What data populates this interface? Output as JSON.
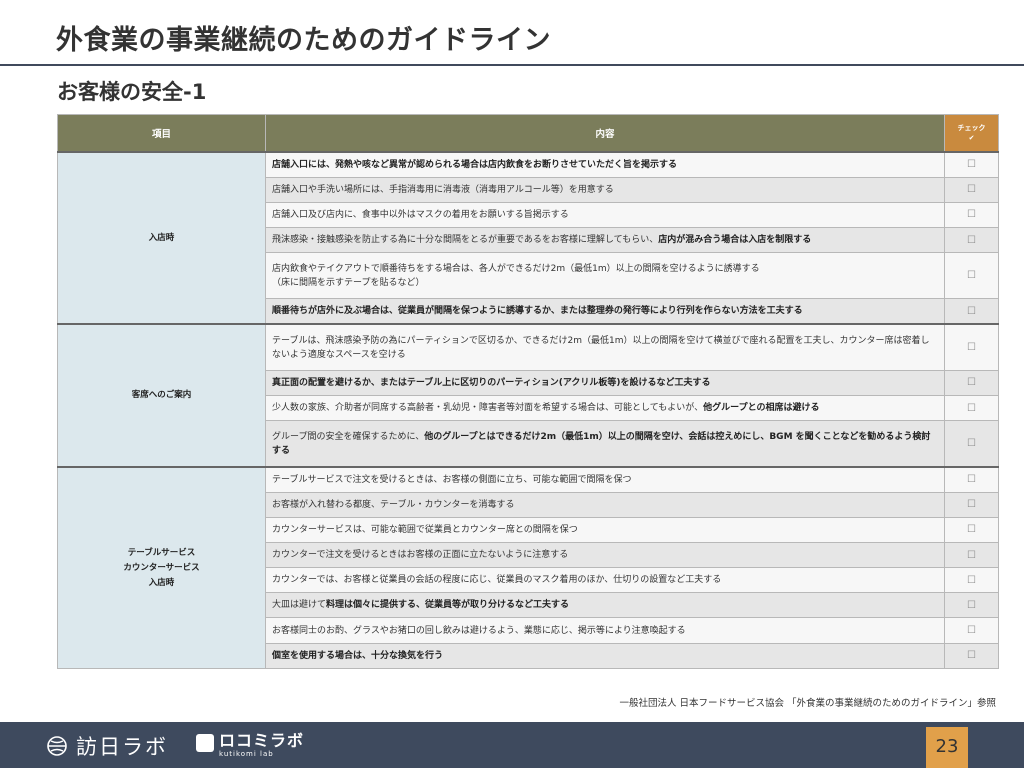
{
  "page": {
    "title": "外食業の事業継続のためのガイドライン",
    "subtitle": "お客様の安全-1"
  },
  "table": {
    "headers": {
      "category": "項目",
      "content": "内容",
      "check": "チェック",
      "check_mark": "✔"
    },
    "checkbox_glyph": "☐",
    "groups": [
      {
        "category_lines": [
          "入店時"
        ],
        "items": [
          {
            "segments": [
              {
                "text": "店舗入口には、発熱や咳など異常が認められる場合は店内飲食をお断りさせていただく旨を掲示する",
                "bold": true
              }
            ]
          },
          {
            "segments": [
              {
                "text": "店舗入口や手洗い場所には、手指消毒用に消毒液（消毒用アルコール等）を用意する",
                "bold": false
              }
            ]
          },
          {
            "segments": [
              {
                "text": "店舗入口及び店内に、食事中以外はマスクの着用をお願いする旨掲示する",
                "bold": false
              }
            ]
          },
          {
            "segments": [
              {
                "text": "飛沫感染・接触感染を防止する為に十分な間隔をとるが重要であるをお客様に理解してもらい、",
                "bold": false
              },
              {
                "text": "店内が混み合う場合は入店を制限する",
                "bold": true
              }
            ]
          },
          {
            "segments": [
              {
                "text": "店内飲食やテイクアウトで順番待ちをする場合は、各人ができるだけ2m（最低1m）以上の間隔を空けるように誘導する\n（床に間隔を示すテープを貼るなど）",
                "bold": false
              }
            ]
          },
          {
            "segments": [
              {
                "text": "順番待ちが店外に及ぶ場合は、従業員が間隔を保つように誘導するか、または整理券の発行等により行列を作らない方法を工夫する",
                "bold": true
              }
            ]
          }
        ]
      },
      {
        "category_lines": [
          "客席へのご案内"
        ],
        "items": [
          {
            "segments": [
              {
                "text": "テーブルは、飛沫感染予防の為にパーティションで区切るか、できるだけ2m（最低1m）以上の間隔を空けて横並びで座れる配置を工夫し、カウンター席は密着しないよう適度なスペースを空ける",
                "bold": false
              }
            ]
          },
          {
            "segments": [
              {
                "text": "真正面の配置を避けるか、またはテーブル上に区切りのパーティション(アクリル板等)を設けるなど工夫する",
                "bold": true
              }
            ]
          },
          {
            "segments": [
              {
                "text": "少人数の家族、介助者が同席する高齢者・乳幼児・障害者等対面を希望する場合は、可能としてもよいが、",
                "bold": false
              },
              {
                "text": "他グループとの相席は避ける",
                "bold": true
              }
            ]
          },
          {
            "segments": [
              {
                "text": "グループ間の安全を確保するために、",
                "bold": false
              },
              {
                "text": "他のグループとはできるだけ2m（最低1m）以上の間隔を空け、会話は控えめにし、BGM を聞くことなどを勧めるよう検討する",
                "bold": true
              }
            ]
          }
        ]
      },
      {
        "category_lines": [
          "テーブルサービス",
          "カウンターサービス",
          "入店時"
        ],
        "items": [
          {
            "segments": [
              {
                "text": "テーブルサービスで注文を受けるときは、お客様の側面に立ち、可能な範囲で間隔を保つ",
                "bold": false
              }
            ]
          },
          {
            "segments": [
              {
                "text": "お客様が入れ替わる都度、テーブル・カウンターを消毒する",
                "bold": false
              }
            ]
          },
          {
            "segments": [
              {
                "text": "カウンターサービスは、可能な範囲で従業員とカウンター席との間隔を保つ",
                "bold": false
              }
            ]
          },
          {
            "segments": [
              {
                "text": "カウンターで注文を受けるときはお客様の正面に立たないように注意する",
                "bold": false
              }
            ]
          },
          {
            "segments": [
              {
                "text": "カウンターでは、お客様と従業員の会話の程度に応じ、従業員のマスク着用のほか、仕切りの設置など工夫する",
                "bold": false
              }
            ]
          },
          {
            "segments": [
              {
                "text": "大皿は避けて",
                "bold": false
              },
              {
                "text": "料理は個々に提供する、従業員等が取り分けるなど工夫する",
                "bold": true
              }
            ]
          },
          {
            "segments": [
              {
                "text": "お客様同士のお酌、グラスやお猪口の回し飲みは避けるよう、業態に応じ、掲示等により注意喚起する",
                "bold": false
              }
            ]
          },
          {
            "segments": [
              {
                "text": "個室を使用する場合は、十分な換気を行う",
                "bold": true
              }
            ]
          }
        ]
      }
    ]
  },
  "reference": "一般社団法人 日本フードサービス協会 「外食業の事業継続のためのガイドライン」参照",
  "footer": {
    "logo1_text": "訪日ラボ",
    "logo2_text": "ロコミラボ",
    "logo2_sub": "kutikomi lab",
    "page_number": "23"
  },
  "colors": {
    "header_bg": "#7b7d5b",
    "check_header_bg": "#c98a3e",
    "category_bg": "#dce8ed",
    "footer_bg": "#3e4a5e",
    "page_number_bg": "#e1a04a"
  }
}
